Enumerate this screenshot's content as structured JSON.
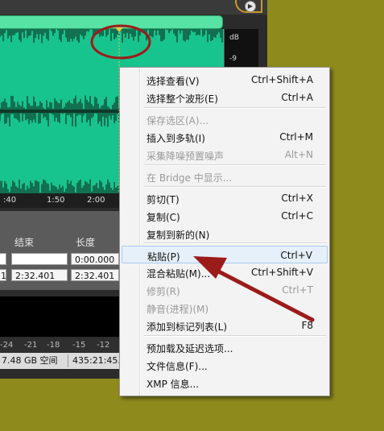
{
  "colors": {
    "waveform": "#18c48d",
    "scrollbar": "#56e3a4",
    "annotation": "#9c1b1b",
    "background": "#8e8a1c"
  },
  "corner_button": {
    "icon": "play-triangle-icon",
    "glyph": "▶"
  },
  "meter": {
    "unit": "dB",
    "tick": "-9"
  },
  "ruler": {
    "ticks": [
      ":40",
      "1:50",
      "2:00"
    ]
  },
  "selection_panel": {
    "headers": {
      "end": "结束",
      "length": "长度"
    },
    "row1": {
      "end": "",
      "length": "0:00.000"
    },
    "row2": {
      "start": "1",
      "end": "2:32.401",
      "length": "2:32.401"
    }
  },
  "db_scale": {
    "ticks": [
      "-24",
      "-21",
      "-18",
      "-15",
      "-12"
    ]
  },
  "status": {
    "disk_space": "7.48 GB 空间",
    "duration": "435:21:45.1"
  },
  "context_menu": {
    "items": [
      {
        "label": "选择查看(V)",
        "shortcut": "Ctrl+Shift+A",
        "enabled": true
      },
      {
        "label": "选择整个波形(E)",
        "shortcut": "Ctrl+A",
        "enabled": true
      },
      {
        "label": "保存选区(A)...",
        "shortcut": "",
        "enabled": false
      },
      {
        "label": "插入到多轨(I)",
        "shortcut": "Ctrl+M",
        "enabled": true
      },
      {
        "label": "采集降噪预置噪声",
        "shortcut": "Alt+N",
        "enabled": false
      },
      {
        "label": "在 Bridge 中显示...",
        "shortcut": "",
        "enabled": false
      },
      {
        "label": "剪切(T)",
        "shortcut": "Ctrl+X",
        "enabled": true
      },
      {
        "label": "复制(C)",
        "shortcut": "Ctrl+C",
        "enabled": true
      },
      {
        "label": "复制到新的(N)",
        "shortcut": "",
        "enabled": true
      },
      {
        "label": "粘贴(P)",
        "shortcut": "Ctrl+V",
        "enabled": true,
        "highlighted": true
      },
      {
        "label": "混合粘贴(M)...",
        "shortcut": "Ctrl+Shift+V",
        "enabled": true
      },
      {
        "label": "修剪(R)",
        "shortcut": "Ctrl+T",
        "enabled": false
      },
      {
        "label": "静音(进程)(M)",
        "shortcut": "",
        "enabled": false
      },
      {
        "label": "添加到标记列表(L)",
        "shortcut": "F8",
        "enabled": true
      },
      {
        "label": "预加载及延迟选项...",
        "shortcut": "",
        "enabled": true
      },
      {
        "label": "文件信息(F)...",
        "shortcut": "",
        "enabled": true
      },
      {
        "label": "XMP 信息...",
        "shortcut": "",
        "enabled": true
      }
    ]
  }
}
